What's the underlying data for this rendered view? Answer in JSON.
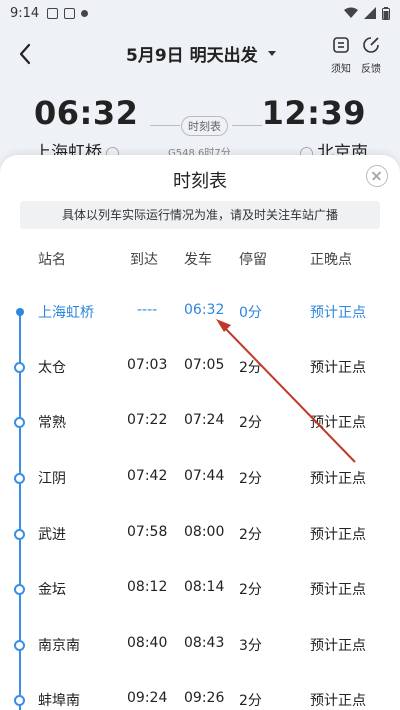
{
  "status_bar": {
    "time": "9:14"
  },
  "header": {
    "title": "5月9日 明天出发",
    "notice_btn": "须知",
    "feedback_btn": "反馈"
  },
  "trip": {
    "dep_time": "06:32",
    "dep_station": "上海虹桥",
    "arr_time": "12:39",
    "arr_station": "北京南",
    "schedule_chip": "时刻表",
    "train_info": "G548 6时7分"
  },
  "sheet": {
    "title": "时刻表",
    "notice": "具体以列车实际运行情况为准，请及时关注车站广播",
    "columns": {
      "name": "站名",
      "arrive": "到达",
      "depart": "发车",
      "stop": "停留",
      "status": "正晚点"
    },
    "rows": [
      {
        "name": "上海虹桥",
        "arrive": "----",
        "depart": "06:32",
        "stop": "0分",
        "status": "预计正点"
      },
      {
        "name": "太仓",
        "arrive": "07:03",
        "depart": "07:05",
        "stop": "2分",
        "status": "预计正点"
      },
      {
        "name": "常熟",
        "arrive": "07:22",
        "depart": "07:24",
        "stop": "2分",
        "status": "预计正点"
      },
      {
        "name": "江阴",
        "arrive": "07:42",
        "depart": "07:44",
        "stop": "2分",
        "status": "预计正点"
      },
      {
        "name": "武进",
        "arrive": "07:58",
        "depart": "08:00",
        "stop": "2分",
        "status": "预计正点"
      },
      {
        "name": "金坛",
        "arrive": "08:12",
        "depart": "08:14",
        "stop": "2分",
        "status": "预计正点"
      },
      {
        "name": "南京南",
        "arrive": "08:40",
        "depart": "08:43",
        "stop": "3分",
        "status": "预计正点"
      },
      {
        "name": "蚌埠南",
        "arrive": "09:24",
        "depart": "09:26",
        "stop": "2分",
        "status": "预计正点"
      }
    ]
  },
  "colors": {
    "accent": "#2e86de",
    "annotation_arrow": "#c0392b"
  }
}
